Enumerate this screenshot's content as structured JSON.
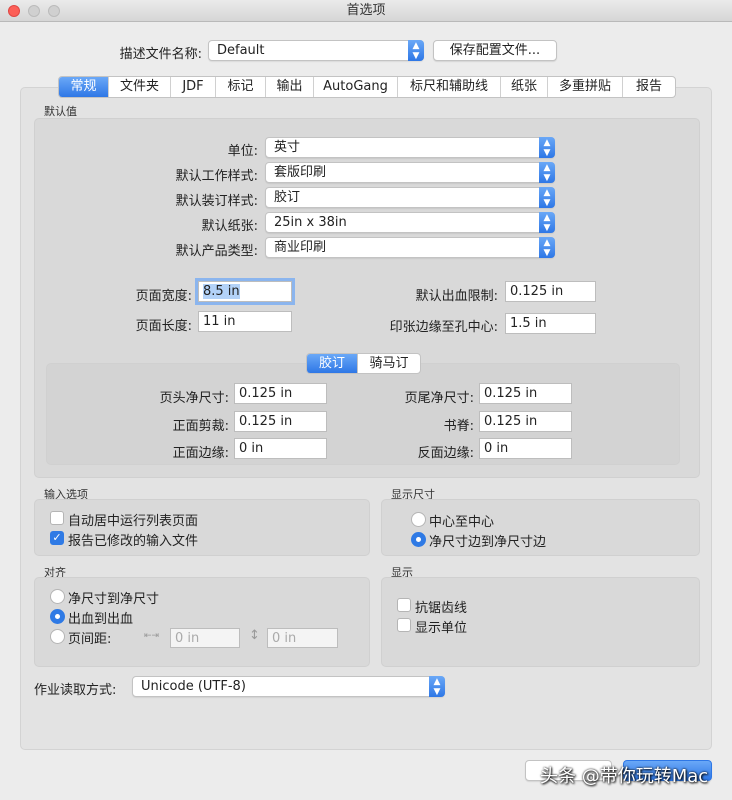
{
  "window": {
    "title": "首选项"
  },
  "profile": {
    "label": "描述文件名称:",
    "value": "Default",
    "save_button": "保存配置文件..."
  },
  "tabs": [
    "常规",
    "文件夹",
    "JDF",
    "标记",
    "输出",
    "AutoGang",
    "标尺和辅助线",
    "纸张",
    "多重拼贴",
    "报告"
  ],
  "defaults": {
    "section_label": "默认值",
    "selects": [
      {
        "label": "单位:",
        "value": "英寸"
      },
      {
        "label": "默认工作样式:",
        "value": "套版印刷"
      },
      {
        "label": "默认装订样式:",
        "value": "胶订"
      },
      {
        "label": "默认纸张:",
        "value": "25in x 38in"
      },
      {
        "label": "默认产品类型:",
        "value": "商业印刷"
      }
    ],
    "page_width": {
      "label": "页面宽度:",
      "value": "8.5 in"
    },
    "page_length": {
      "label": "页面长度:",
      "value": "11 in"
    },
    "bleed_limit": {
      "label": "默认出血限制:",
      "value": "0.125 in"
    },
    "edge_to_hole": {
      "label": "印张边缘至孔中心:",
      "value": "1.5 in"
    },
    "binding_tabs": [
      "胶订",
      "骑马订"
    ],
    "binding": {
      "head_trim": {
        "label": "页头净尺寸:",
        "value": "0.125 in"
      },
      "foot_trim": {
        "label": "页尾净尺寸:",
        "value": "0.125 in"
      },
      "face_trim": {
        "label": "正面剪裁:",
        "value": "0.125 in"
      },
      "spine": {
        "label": "书脊:",
        "value": "0.125 in"
      },
      "front_margin": {
        "label": "正面边缘:",
        "value": "0 in"
      },
      "back_margin": {
        "label": "反面边缘:",
        "value": "0 in"
      }
    }
  },
  "input_options": {
    "label": "输入选项",
    "items": [
      {
        "label": "自动居中运行列表页面",
        "checked": false
      },
      {
        "label": "报告已修改的输入文件",
        "checked": true
      }
    ]
  },
  "display_size": {
    "label": "显示尺寸",
    "items": [
      {
        "label": "中心至中心",
        "selected": false
      },
      {
        "label": "净尺寸边到净尺寸边",
        "selected": true
      }
    ]
  },
  "align": {
    "label": "对齐",
    "items": [
      {
        "label": "净尺寸到净尺寸",
        "selected": false
      },
      {
        "label": "出血到出血",
        "selected": true
      },
      {
        "label": "页间距:",
        "selected": false
      }
    ],
    "h_gap": "0 in",
    "v_gap": "0 in"
  },
  "display": {
    "label": "显示",
    "items": [
      {
        "label": "抗锯齿线",
        "checked": false
      },
      {
        "label": "显示单位",
        "checked": false
      }
    ]
  },
  "job_read": {
    "label": "作业读取方式:",
    "value": "Unicode (UTF-8)"
  },
  "watermark": "头条 @带你玩转Mac",
  "colors": {
    "accent": "#2f7ae5",
    "close": "#fc5f57"
  }
}
